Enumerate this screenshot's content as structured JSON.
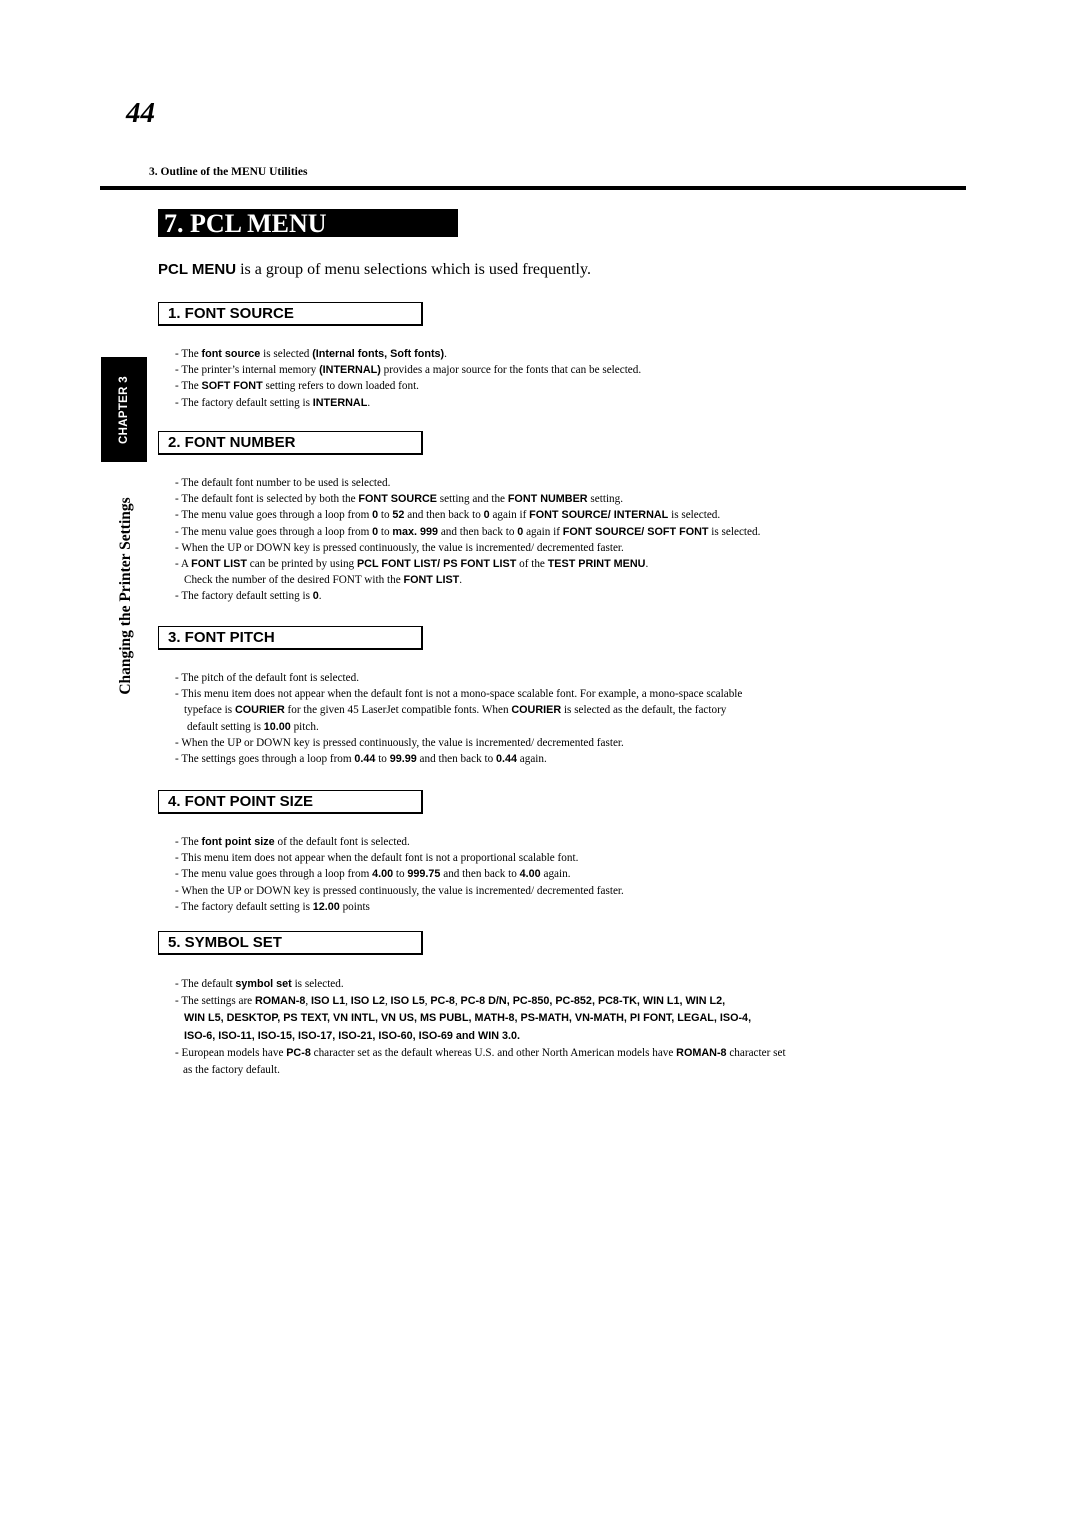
{
  "page_number": "44",
  "running_head": "3. Outline of the MENU Utilities",
  "chapter_tab": "CHAPTER 3",
  "side_title": "Changing the Printer Settings",
  "title": "7. PCL MENU",
  "intro": [
    {
      "t": "PCL MENU",
      "b": true
    },
    {
      "t": " is a group of menu selections which is used frequently.",
      "b": false
    }
  ],
  "sections": [
    {
      "heading": "1. FONT SOURCE",
      "lines": [
        {
          "indent": 0,
          "segs": [
            {
              "t": "- The ",
              "b": false
            },
            {
              "t": "font source",
              "b": true
            },
            {
              "t": " is selected ",
              "b": false
            },
            {
              "t": "(Internal fonts, Soft fonts)",
              "b": true
            },
            {
              "t": ".",
              "b": false
            }
          ]
        },
        {
          "indent": 0,
          "segs": [
            {
              "t": "- The printer’s internal memory ",
              "b": false
            },
            {
              "t": "(INTERNAL)",
              "b": true
            },
            {
              "t": " provides a major source for the fonts that can be selected.",
              "b": false
            }
          ]
        },
        {
          "indent": 0,
          "segs": [
            {
              "t": "- The ",
              "b": false
            },
            {
              "t": "SOFT FONT",
              "b": true
            },
            {
              "t": " setting refers to down loaded font.",
              "b": false
            }
          ]
        },
        {
          "indent": 0,
          "segs": [
            {
              "t": "- The factory default setting is ",
              "b": false
            },
            {
              "t": "INTERNAL",
              "b": true
            },
            {
              "t": ".",
              "b": false
            }
          ]
        }
      ]
    },
    {
      "heading": "2. FONT NUMBER",
      "lines": [
        {
          "indent": 0,
          "segs": [
            {
              "t": "- The default font number to be used is selected.",
              "b": false
            }
          ]
        },
        {
          "indent": 0,
          "segs": [
            {
              "t": "- The default font is selected by both the ",
              "b": false
            },
            {
              "t": "FONT SOURCE",
              "b": true
            },
            {
              "t": " setting and the ",
              "b": false
            },
            {
              "t": "FONT NUMBER",
              "b": true
            },
            {
              "t": " setting.",
              "b": false
            }
          ]
        },
        {
          "indent": 0,
          "segs": [
            {
              "t": "- The menu value goes through a loop from ",
              "b": false
            },
            {
              "t": "0",
              "b": true
            },
            {
              "t": " to ",
              "b": false
            },
            {
              "t": "52",
              "b": true
            },
            {
              "t": " and then back to ",
              "b": false
            },
            {
              "t": "0",
              "b": true
            },
            {
              "t": " again if ",
              "b": false
            },
            {
              "t": "FONT SOURCE/ INTERNAL",
              "b": true
            },
            {
              "t": " is selected.",
              "b": false
            }
          ]
        },
        {
          "indent": 0,
          "segs": [
            {
              "t": "- The menu value goes through a loop from ",
              "b": false
            },
            {
              "t": "0",
              "b": true
            },
            {
              "t": " to ",
              "b": false
            },
            {
              "t": "max. 999",
              "b": true
            },
            {
              "t": " and then back to ",
              "b": false
            },
            {
              "t": "0",
              "b": true
            },
            {
              "t": " again if ",
              "b": false
            },
            {
              "t": "FONT SOURCE/ SOFT FONT",
              "b": true
            },
            {
              "t": " is selected.",
              "b": false
            }
          ]
        },
        {
          "indent": 0,
          "segs": [
            {
              "t": "- When the UP or DOWN key is pressed continuously, the value is incremented/ decremented faster.",
              "b": false
            }
          ]
        },
        {
          "indent": 0,
          "segs": [
            {
              "t": "- A ",
              "b": false
            },
            {
              "t": "FONT LIST",
              "b": true
            },
            {
              "t": " can be printed by using ",
              "b": false
            },
            {
              "t": "PCL FONT LIST/ PS FONT LIST",
              "b": true
            },
            {
              "t": " of the ",
              "b": false
            },
            {
              "t": "TEST PRINT MENU",
              "b": true
            },
            {
              "t": ".",
              "b": false
            }
          ]
        },
        {
          "indent": 1,
          "segs": [
            {
              "t": "Check the number of the desired FONT with the ",
              "b": false
            },
            {
              "t": "FONT LIST",
              "b": true
            },
            {
              "t": ".",
              "b": false
            }
          ]
        },
        {
          "indent": 0,
          "segs": [
            {
              "t": "- The factory default setting is ",
              "b": false
            },
            {
              "t": "0",
              "b": true
            },
            {
              "t": ".",
              "b": false
            }
          ]
        }
      ]
    },
    {
      "heading": "3. FONT PITCH",
      "lines": [
        {
          "indent": 0,
          "segs": [
            {
              "t": "- The  pitch of the default font is selected.",
              "b": false
            }
          ]
        },
        {
          "indent": 0,
          "segs": [
            {
              "t": "- This menu item does not appear when the default font is not a mono-space scalable font. For example, a mono-space scalable",
              "b": false
            }
          ]
        },
        {
          "indent": 1,
          "segs": [
            {
              "t": "typeface is ",
              "b": false
            },
            {
              "t": "COURIER",
              "b": true
            },
            {
              "t": " for the given 45 LaserJet compatible fonts. When ",
              "b": false
            },
            {
              "t": "COURIER",
              "b": true
            },
            {
              "t": " is selected as the default, the factory",
              "b": false
            }
          ]
        },
        {
          "indent": 2,
          "segs": [
            {
              "t": "default setting is ",
              "b": false
            },
            {
              "t": "10.00",
              "b": true
            },
            {
              "t": " pitch.",
              "b": false
            }
          ]
        },
        {
          "indent": 0,
          "segs": [
            {
              "t": "- When the UP or DOWN key is pressed continuously, the value is incremented/ decremented faster.",
              "b": false
            }
          ]
        },
        {
          "indent": 0,
          "segs": [
            {
              "t": "- The settings goes through a loop from ",
              "b": false
            },
            {
              "t": "0.44",
              "b": true
            },
            {
              "t": " to ",
              "b": false
            },
            {
              "t": "99.99",
              "b": true
            },
            {
              "t": " and then back to ",
              "b": false
            },
            {
              "t": "0.44",
              "b": true
            },
            {
              "t": " again.",
              "b": false
            }
          ]
        }
      ]
    },
    {
      "heading": "4. FONT POINT SIZE",
      "lines": [
        {
          "indent": 0,
          "segs": [
            {
              "t": "- The  ",
              "b": false
            },
            {
              "t": "font point size",
              "b": true
            },
            {
              "t": " of the default font is selected.",
              "b": false
            }
          ]
        },
        {
          "indent": 0,
          "segs": [
            {
              "t": "- This menu item does not appear when the default font is not a proportional scalable font.",
              "b": false
            }
          ]
        },
        {
          "indent": 0,
          "segs": [
            {
              "t": "- The menu value goes through a loop from ",
              "b": false
            },
            {
              "t": "4.00",
              "b": true
            },
            {
              "t": " to ",
              "b": false
            },
            {
              "t": "999.75",
              "b": true
            },
            {
              "t": " and then back to ",
              "b": false
            },
            {
              "t": "4.00",
              "b": true
            },
            {
              "t": " again.",
              "b": false
            }
          ]
        },
        {
          "indent": 0,
          "segs": [
            {
              "t": "- When the UP or DOWN key is pressed continuously, the value is incremented/ decremented faster.",
              "b": false
            }
          ]
        },
        {
          "indent": 0,
          "segs": [
            {
              "t": "- The factory default setting is ",
              "b": false
            },
            {
              "t": "12.00",
              "b": true
            },
            {
              "t": " points",
              "b": false
            }
          ]
        }
      ]
    },
    {
      "heading": "5. SYMBOL SET",
      "lines": [
        {
          "indent": 0,
          "segs": [
            {
              "t": "- The default ",
              "b": false
            },
            {
              "t": "symbol set",
              "b": true
            },
            {
              "t": " is selected.",
              "b": false
            }
          ]
        },
        {
          "indent": 0,
          "segs": [
            {
              "t": "- The settings are ",
              "b": false
            },
            {
              "t": "ROMAN-8",
              "b": true
            },
            {
              "t": ", ",
              "b": false
            },
            {
              "t": "ISO L1",
              "b": true
            },
            {
              "t": ", ",
              "b": false
            },
            {
              "t": "ISO L2",
              "b": true
            },
            {
              "t": ", ",
              "b": false
            },
            {
              "t": "ISO L5",
              "b": true
            },
            {
              "t": ", ",
              "b": false
            },
            {
              "t": "PC-8",
              "b": true
            },
            {
              "t": ", ",
              "b": false
            },
            {
              "t": "PC-8 D/N, PC-850, PC-852, PC8-TK, WIN L1, WIN L2,",
              "b": true
            }
          ]
        },
        {
          "indent": 1,
          "segs": [
            {
              "t": "WIN L5, DESKTOP, PS TEXT, VN INTL, VN US, MS PUBL, MATH-8, PS-MATH, VN-MATH, PI FONT, LEGAL, ISO-4,",
              "b": true
            }
          ]
        },
        {
          "indent": 1,
          "segs": [
            {
              "t": "ISO-6, ISO-11, ISO-15, ISO-17, ISO-21, ISO-60, ISO-69 and WIN 3.0.",
              "b": true
            }
          ]
        },
        {
          "indent": 0,
          "segs": [
            {
              "t": "- European models have ",
              "b": false
            },
            {
              "t": "PC-8",
              "b": true
            },
            {
              "t": " character set as the default whereas U.S. and other North American models have ",
              "b": false
            },
            {
              "t": "ROMAN-8",
              "b": true
            },
            {
              "t": " character set",
              "b": false
            }
          ]
        },
        {
          "indent": 3,
          "segs": [
            {
              "t": "as the factory default.",
              "b": false
            }
          ]
        }
      ]
    }
  ]
}
